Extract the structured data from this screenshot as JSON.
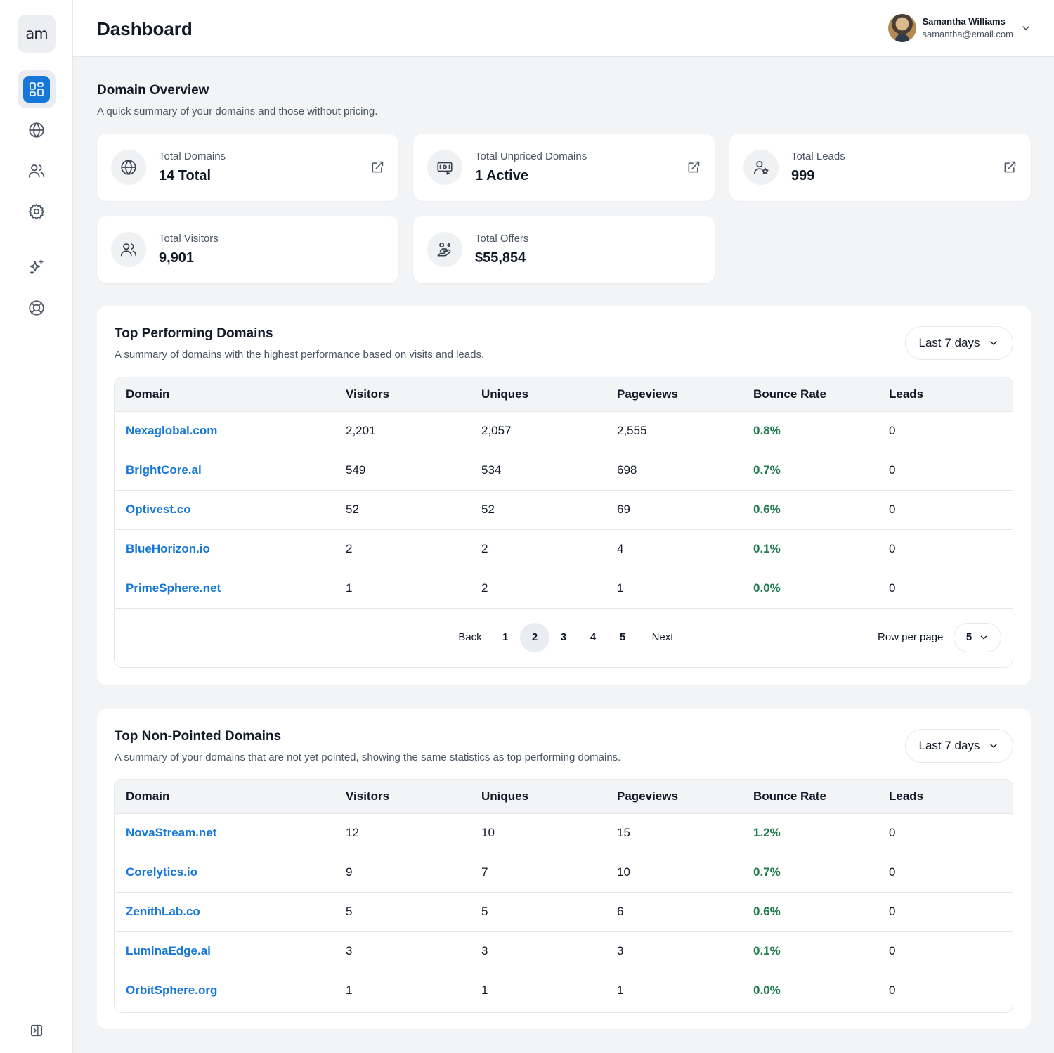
{
  "app": {
    "logo_text": "am",
    "page_title": "Dashboard"
  },
  "sidebar": {
    "items": [
      {
        "icon": "dashboard-icon",
        "active": true
      },
      {
        "icon": "globe-icon"
      },
      {
        "icon": "users-icon"
      },
      {
        "icon": "settings-icon"
      },
      {
        "icon": "sparkles-icon"
      },
      {
        "icon": "lifebuoy-icon"
      }
    ],
    "collapse_icon": "sidebar-collapse-icon"
  },
  "user": {
    "name": "Samantha Williams",
    "email": "samantha@email.com"
  },
  "overview": {
    "title": "Domain Overview",
    "subtitle": "A quick summary of your domains and those without pricing.",
    "cards": [
      {
        "label": "Total Domains",
        "value": "14 Total",
        "icon": "globe-icon"
      },
      {
        "label": "Total Unpriced Domains",
        "value": "1 Active",
        "icon": "money-card-icon"
      },
      {
        "label": "Total Leads",
        "value": "999",
        "icon": "user-star-icon"
      },
      {
        "label": "Total Visitors",
        "value": "9,901",
        "icon": "users-icon"
      },
      {
        "label": "Total Offers",
        "value": "$55,854",
        "icon": "handshake-offer-icon"
      }
    ]
  },
  "columns": [
    "Domain",
    "Visitors",
    "Uniques",
    "Pageviews",
    "Bounce Rate",
    "Leads"
  ],
  "top_performing": {
    "title": "Top Performing Domains",
    "subtitle": "A summary of domains with the highest performance based on visits and leads.",
    "range": "Last 7 days",
    "rows": [
      [
        "Nexaglobal.com",
        "2,201",
        "2,057",
        "2,555",
        "0.8%",
        "0"
      ],
      [
        "BrightCore.ai",
        "549",
        "534",
        "698",
        "0.7%",
        "0"
      ],
      [
        "Optivest.co",
        "52",
        "52",
        "69",
        "0.6%",
        "0"
      ],
      [
        "BlueHorizon.io",
        "2",
        "2",
        "4",
        "0.1%",
        "0"
      ],
      [
        "PrimeSphere.net",
        "1",
        "2",
        "1",
        "0.0%",
        "0"
      ]
    ],
    "pager": {
      "back": "Back",
      "pages": [
        "1",
        "2",
        "3",
        "4",
        "5"
      ],
      "current": "2",
      "next": "Next",
      "rows_per_page_label": "Row per page",
      "rows_per_page": "5"
    }
  },
  "non_pointed": {
    "title": "Top Non-Pointed Domains",
    "subtitle": "A summary of your domains that are not yet pointed, showing the same statistics as top performing domains.",
    "range": "Last 7 days",
    "rows": [
      [
        "NovaStream.net",
        "12",
        "10",
        "15",
        "1.2%",
        "0"
      ],
      [
        "Corelytics.io",
        "9",
        "7",
        "10",
        "0.7%",
        "0"
      ],
      [
        "ZenithLab.co",
        "5",
        "5",
        "6",
        "0.6%",
        "0"
      ],
      [
        "LuminaEdge.ai",
        "3",
        "3",
        "3",
        "0.1%",
        "0"
      ],
      [
        "OrbitSphere.org",
        "1",
        "1",
        "1",
        "0.0%",
        "0"
      ]
    ]
  },
  "colors": {
    "accent": "#1677d9",
    "bounce_green": "#1f7a4d",
    "background": "#f3f4f6"
  }
}
